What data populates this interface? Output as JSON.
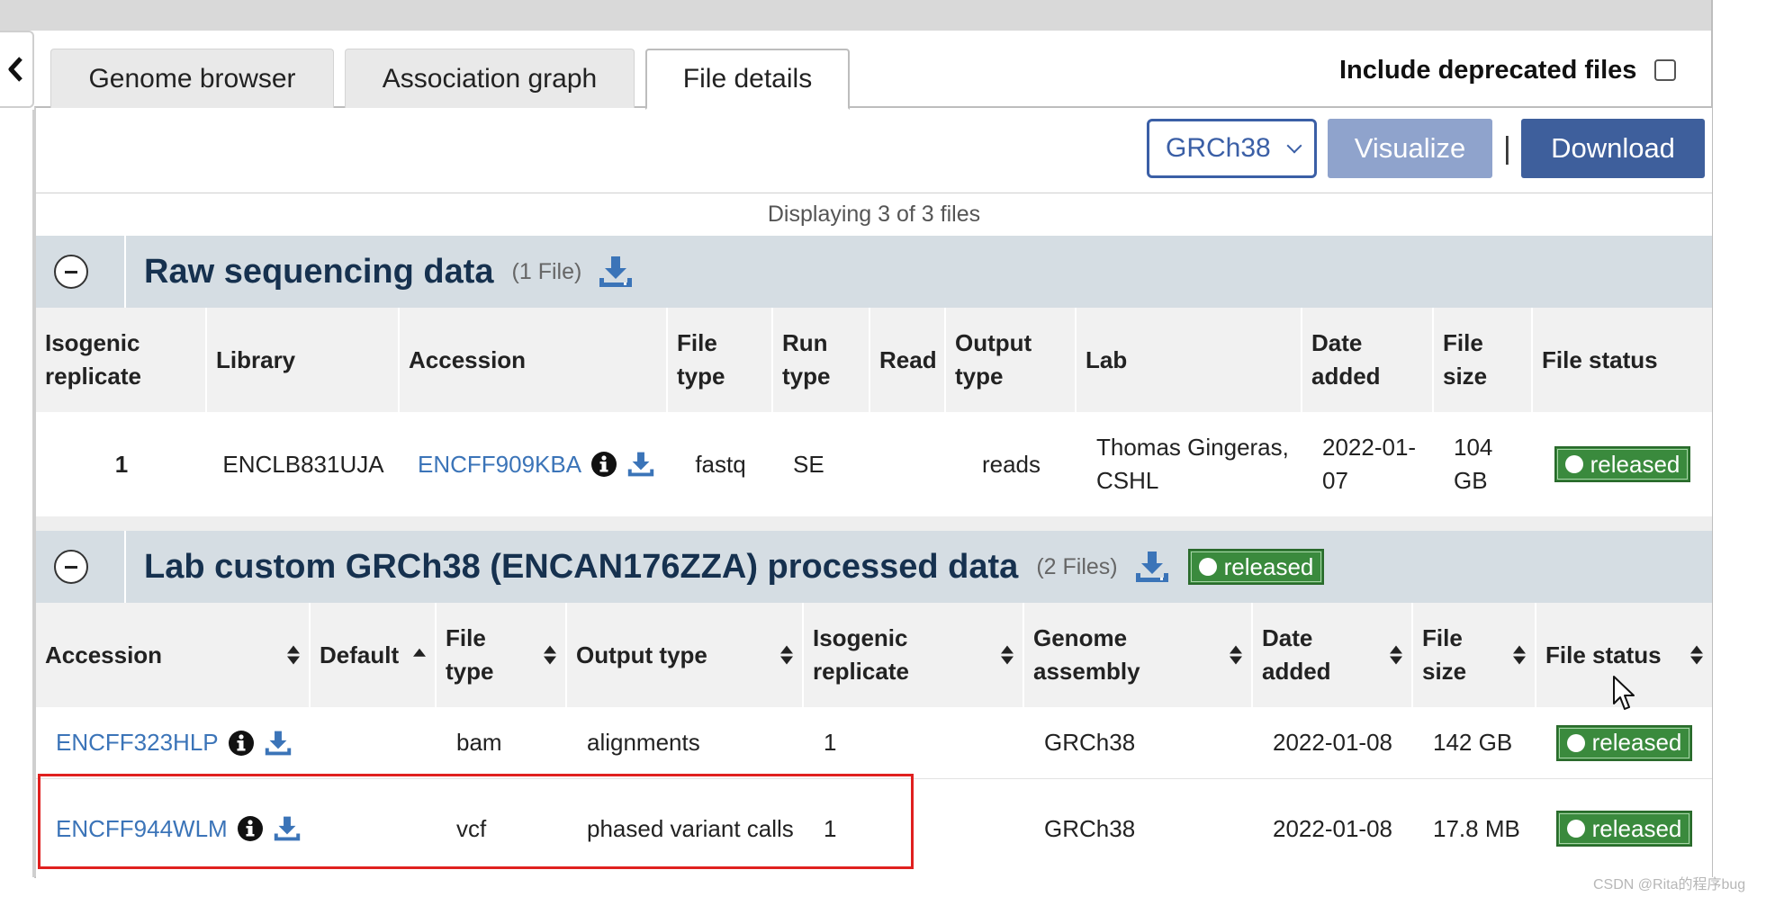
{
  "tabs": [
    {
      "label": "Genome browser"
    },
    {
      "label": "Association graph"
    },
    {
      "label": "File details",
      "active": true
    }
  ],
  "deprecated_label": "Include deprecated files",
  "toolbar": {
    "assembly_selected": "GRCh38",
    "visualize_label": "Visualize",
    "separator": "|",
    "download_label": "Download"
  },
  "display_count": "Displaying 3 of 3 files",
  "raw_group": {
    "title": "Raw sequencing data",
    "count": "(1 File)",
    "columns": [
      "Isogenic replicate",
      "Library",
      "Accession",
      "File type",
      "Run type",
      "Read",
      "Output type",
      "Lab",
      "Date added",
      "File size",
      "File status"
    ],
    "rows": [
      {
        "isogenic_replicate": "1",
        "library": "ENCLB831UJA",
        "accession": "ENCFF909KBA",
        "file_type": "fastq",
        "run_type": "SE",
        "read": "",
        "output_type": "reads",
        "lab": "Thomas Gingeras, CSHL",
        "date_added": "2022-01-07",
        "file_size": "104 GB",
        "file_status": "released"
      }
    ]
  },
  "processed_group": {
    "title": "Lab custom GRCh38 (ENCAN176ZZA) processed data",
    "count": "(2 Files)",
    "status": "released",
    "columns": [
      "Accession",
      "Default",
      "File type",
      "Output type",
      "Isogenic replicate",
      "Genome assembly",
      "Date added",
      "File size",
      "File status"
    ],
    "rows": [
      {
        "accession": "ENCFF323HLP",
        "default": "",
        "file_type": "bam",
        "output_type": "alignments",
        "isogenic_replicate": "1",
        "genome_assembly": "GRCh38",
        "date_added": "2022-01-08",
        "file_size": "142 GB",
        "file_status": "released"
      },
      {
        "accession": "ENCFF944WLM",
        "default": "",
        "file_type": "vcf",
        "output_type": "phased variant calls",
        "isogenic_replicate": "1",
        "genome_assembly": "GRCh38",
        "date_added": "2022-01-08",
        "file_size": "17.8 MB",
        "file_status": "released"
      }
    ]
  },
  "colors": {
    "link": "#3b74b8",
    "primary_button": "#3e5f9c",
    "disabled_button": "#8fa3cc",
    "status_released": "#3a8a3d",
    "group_header_bg": "#d5dde3",
    "highlight_box": "#e0201f"
  },
  "icons": {
    "back": "chevron-left-icon",
    "download": "download-icon",
    "info": "info-circle-icon",
    "collapse": "minus-circle-icon",
    "sort": "sort-icon",
    "cursor": "mouse-cursor-icon"
  },
  "watermark": "CSDN @Rita的程序bug"
}
